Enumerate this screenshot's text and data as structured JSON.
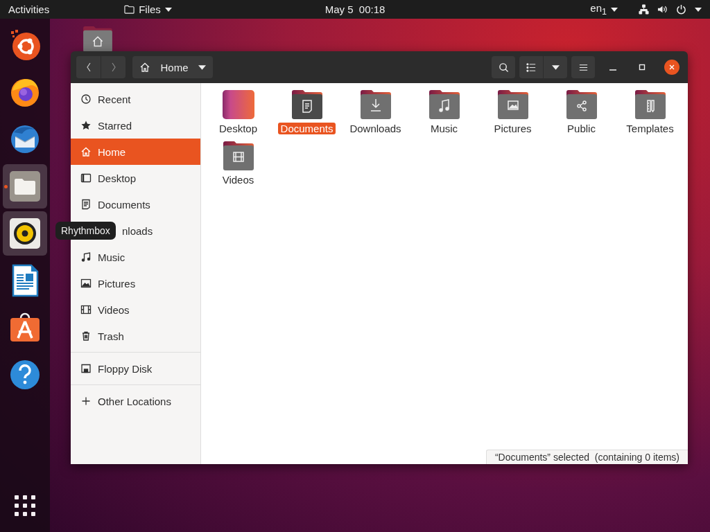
{
  "top_bar": {
    "activities": "Activities",
    "app_menu": "Files",
    "clock": "May 5  00:18",
    "input_source": "en$_{1}$"
  },
  "dock": {
    "items": [
      {
        "kind": "ubuntu",
        "highlighted": false,
        "running": false
      },
      {
        "kind": "firefox",
        "highlighted": false,
        "running": false
      },
      {
        "kind": "thunderbird",
        "highlighted": false,
        "running": false
      },
      {
        "kind": "files",
        "highlighted": true,
        "running": true
      },
      {
        "kind": "rhythmbox",
        "highlighted": true,
        "running": false
      },
      {
        "kind": "writer",
        "highlighted": false,
        "running": false
      },
      {
        "kind": "software",
        "highlighted": false,
        "running": false
      },
      {
        "kind": "help",
        "highlighted": false,
        "running": false
      }
    ],
    "tooltip": "Rhythmbox"
  },
  "window": {
    "location": "Home",
    "sidebar": [
      {
        "items": [
          {
            "kind": "recent",
            "label": "Recent",
            "selected": false,
            "covered": false
          },
          {
            "kind": "star",
            "label": "Starred",
            "selected": false,
            "covered": false
          },
          {
            "kind": "home",
            "label": "Home",
            "selected": true,
            "covered": false
          },
          {
            "kind": "desktop",
            "label": "Desktop",
            "selected": false,
            "covered": false
          },
          {
            "kind": "document",
            "label": "Documents",
            "selected": false,
            "covered": false
          },
          {
            "label": "nloads",
            "selected": false,
            "covered": true
          },
          {
            "kind": "music",
            "label": "Music",
            "selected": false,
            "covered": false
          },
          {
            "kind": "picture",
            "label": "Pictures",
            "selected": false,
            "covered": false
          },
          {
            "kind": "video",
            "label": "Videos",
            "selected": false,
            "covered": false
          },
          {
            "kind": "trash",
            "label": "Trash",
            "selected": false,
            "covered": false
          }
        ]
      },
      {
        "items": [
          {
            "kind": "floppy",
            "label": "Floppy Disk",
            "selected": false,
            "covered": false
          }
        ]
      },
      {
        "items": [
          {
            "kind": "plus",
            "label": "Other Locations",
            "selected": false,
            "covered": false
          }
        ]
      }
    ],
    "files": [
      {
        "kind": "desktop",
        "label": "Desktop",
        "selected": false
      },
      {
        "kind": "document",
        "label": "Documents",
        "selected": true
      },
      {
        "kind": "download",
        "label": "Downloads",
        "selected": false
      },
      {
        "kind": "music",
        "label": "Music",
        "selected": false
      },
      {
        "kind": "picture",
        "label": "Pictures",
        "selected": false
      },
      {
        "kind": "share",
        "label": "Public",
        "selected": false
      },
      {
        "kind": "template",
        "label": "Templates",
        "selected": false
      },
      {
        "kind": "video",
        "label": "Videos",
        "selected": false
      }
    ],
    "status": "“Documents” selected  (containing 0 items)"
  }
}
